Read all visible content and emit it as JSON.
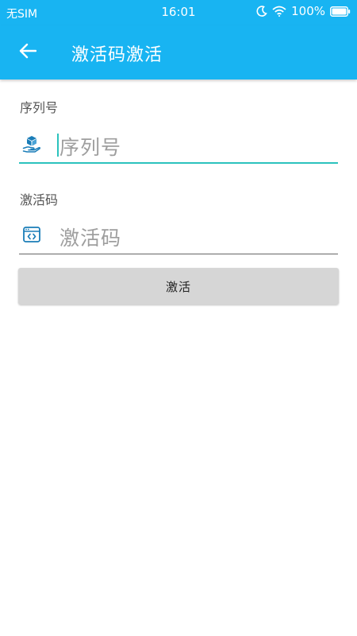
{
  "status_bar": {
    "carrier": "无SIM",
    "time": "16:01",
    "battery": "100%"
  },
  "app_bar": {
    "title": "激活码激活",
    "back_icon": "arrow-left-icon"
  },
  "form": {
    "serial": {
      "label": "序列号",
      "placeholder": "序列号",
      "icon": "box-hand-icon",
      "focused": true
    },
    "code": {
      "label": "激活码",
      "placeholder": "激活码",
      "icon": "code-window-icon",
      "focused": false
    },
    "submit_label": "激活"
  },
  "colors": {
    "primary": "#18b4f2",
    "accent": "#2bc2bd",
    "icon": "#1a7db8",
    "button_bg": "#d6d6d6"
  }
}
